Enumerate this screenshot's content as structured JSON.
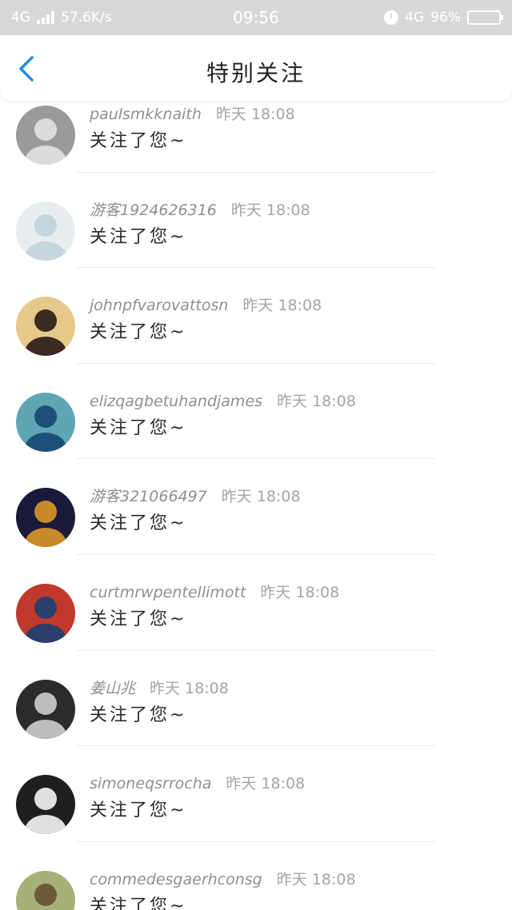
{
  "status_bar": {
    "network": "4G",
    "speed": "57.6K/s",
    "time": "09:56",
    "network_right": "4G",
    "battery": "96%"
  },
  "header": {
    "back_icon": "chevron-left-icon",
    "title": "特别关注"
  },
  "colors": {
    "accent": "#1e8ee8",
    "status_bar_bg": "#d8d8d8"
  },
  "list": [
    {
      "name": "paulsmkknaith",
      "time": "昨天 18:08",
      "message": "关注了您~"
    },
    {
      "name": "游客1924626316",
      "time": "昨天 18:08",
      "message": "关注了您~"
    },
    {
      "name": "johnpfvarovattosn",
      "time": "昨天 18:08",
      "message": "关注了您~"
    },
    {
      "name": "elizqagbetuhandjames",
      "time": "昨天 18:08",
      "message": "关注了您~"
    },
    {
      "name": "游客321066497",
      "time": "昨天 18:08",
      "message": "关注了您~"
    },
    {
      "name": "curtmrwpentellimott",
      "time": "昨天 18:08",
      "message": "关注了您~"
    },
    {
      "name": "姜山兆",
      "time": "昨天 18:08",
      "message": "关注了您~"
    },
    {
      "name": "simoneqsrrocha",
      "time": "昨天 18:08",
      "message": "关注了您~"
    },
    {
      "name": "commedesgaerhconsg",
      "time": "昨天 18:08",
      "message": "关注了您~"
    }
  ]
}
